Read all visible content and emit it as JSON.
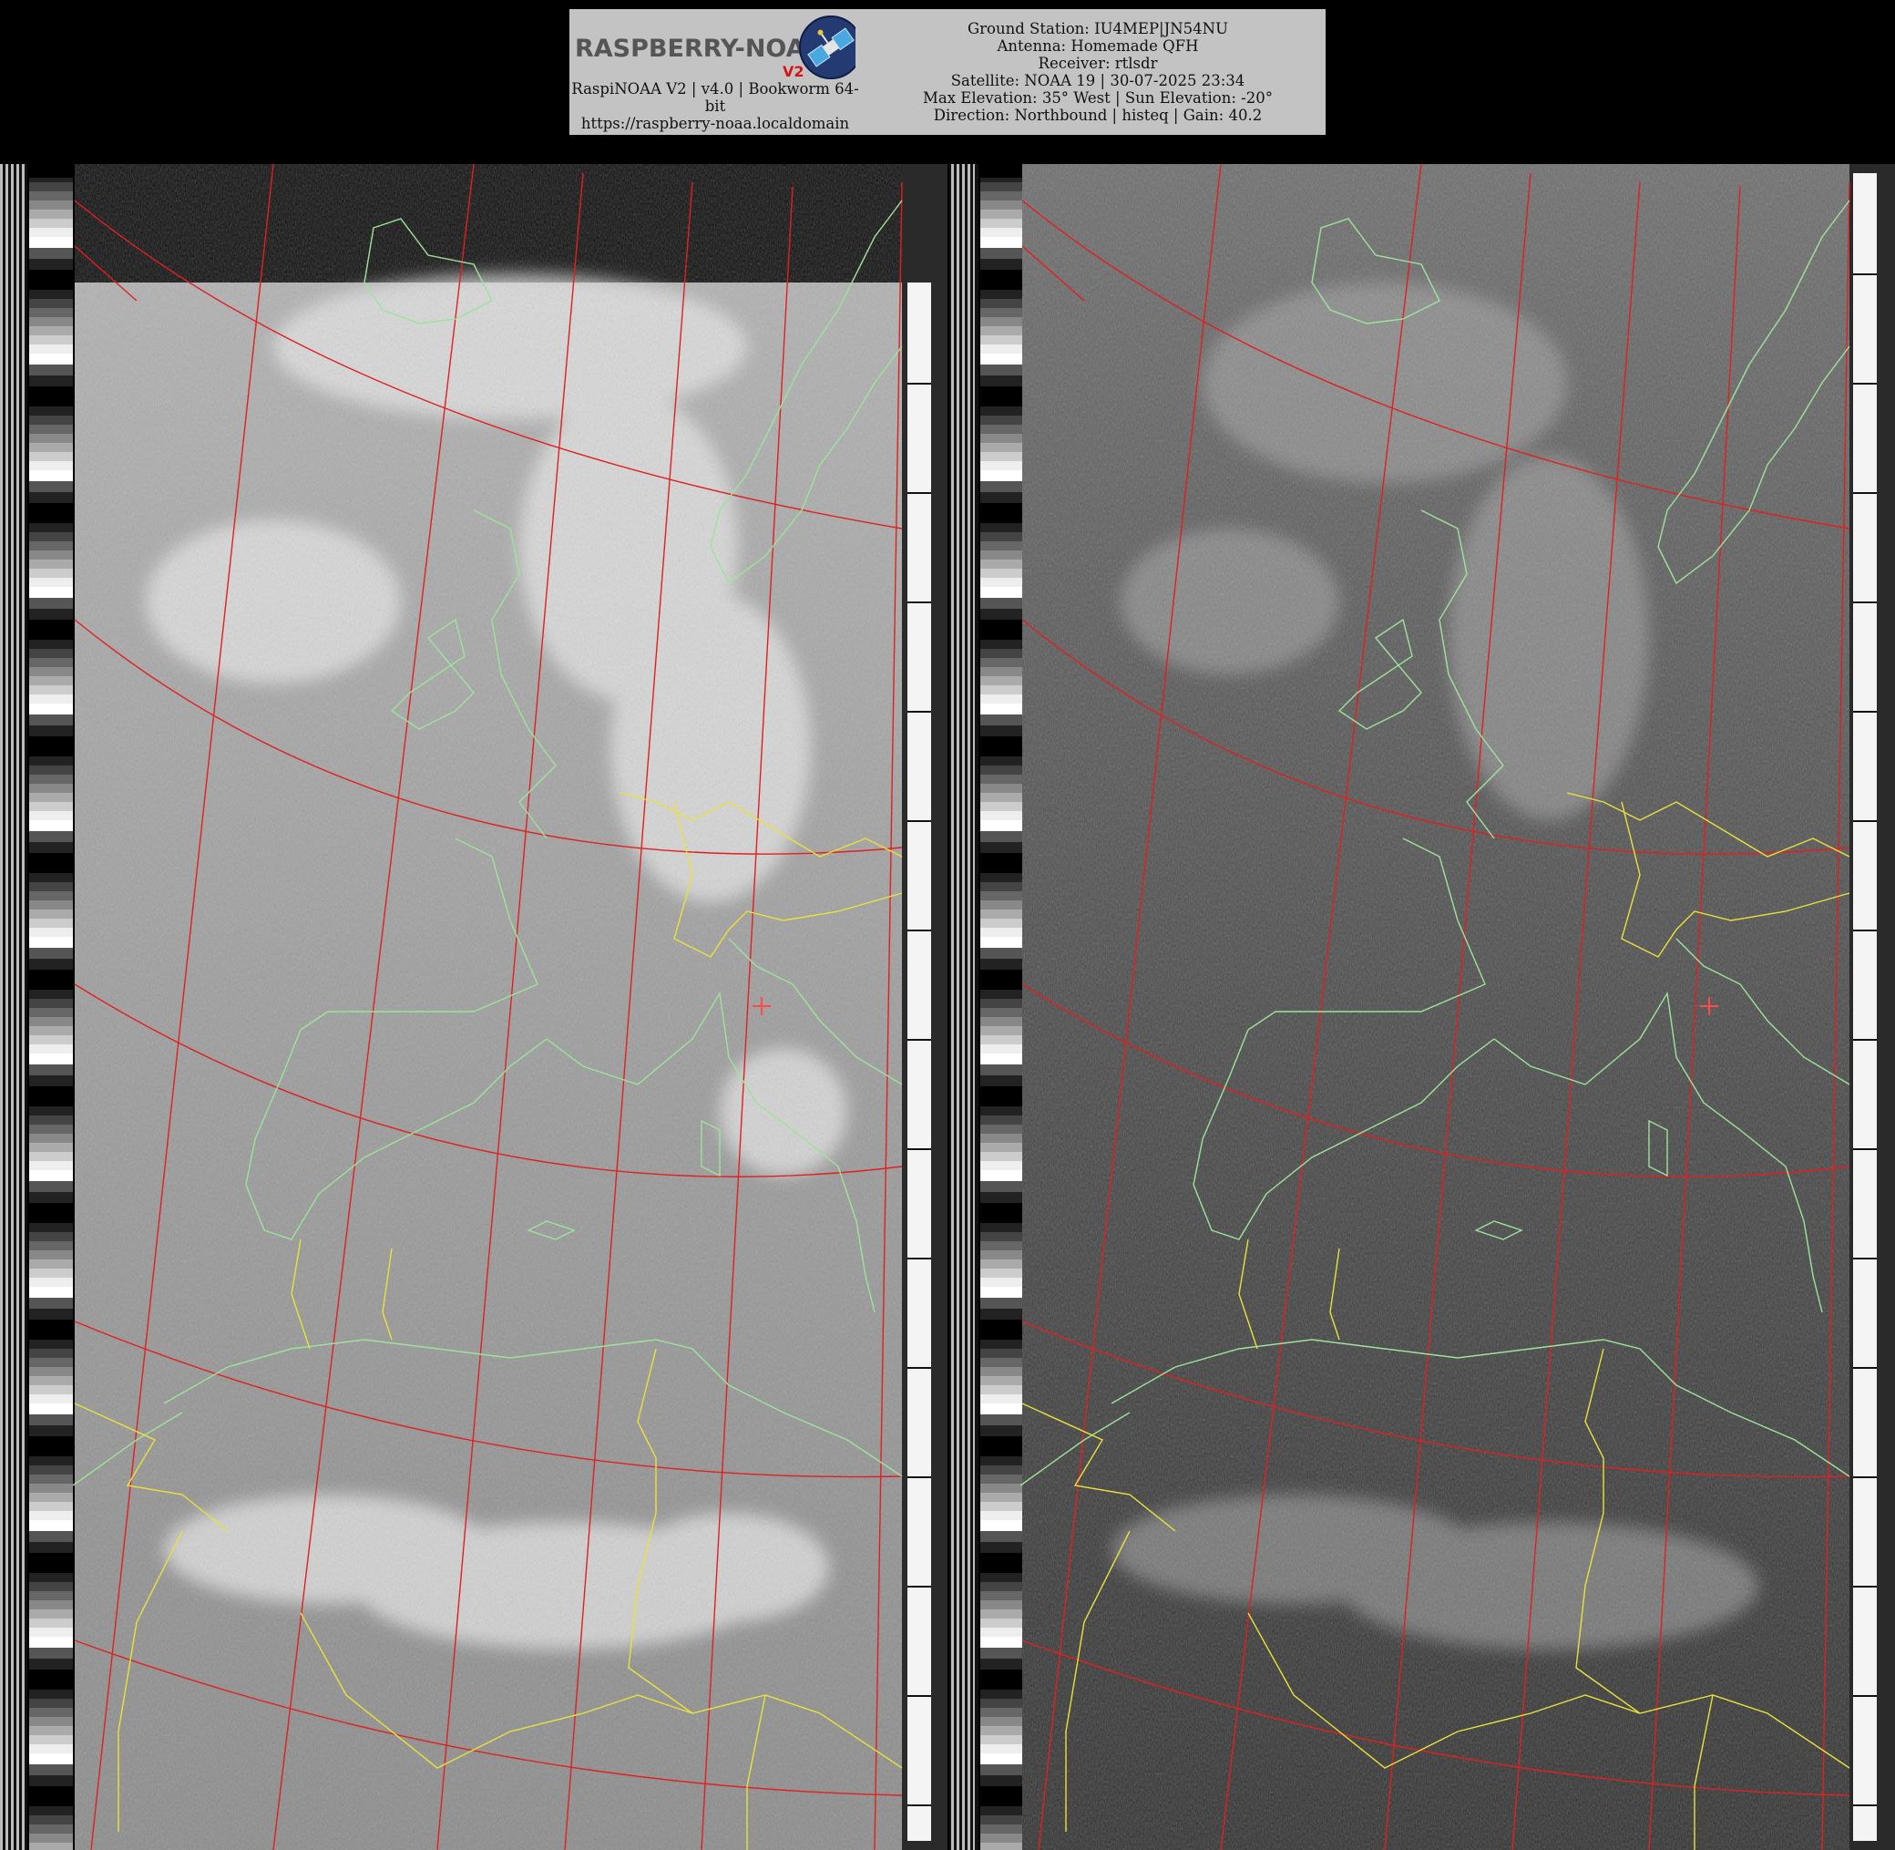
{
  "header": {
    "logo": {
      "wordmark": "RASPBERRY-NOAA",
      "badge": "V2",
      "icon": "satellite-icon"
    },
    "left_lines": [
      "RaspiNOAA V2 | v4.0 | Bookworm 64-",
      "bit",
      "https://raspberry-noaa.localdomain"
    ],
    "right_lines": [
      "Ground Station: IU4MEP|JN54NU",
      "Antenna: Homemade QFH",
      "Receiver: rtlsdr",
      "Satellite: NOAA 19 | 30-07-2025 23:34",
      "Max Elevation: 35° West | Sun Elevation: -20°",
      "Direction: Northbound | histeq | Gain: 40.2"
    ]
  },
  "imagery": {
    "panels": [
      {
        "channel": "A",
        "tone": "light"
      },
      {
        "channel": "B",
        "tone": "dark"
      }
    ],
    "overlay_colors": {
      "graticule": "#e02020",
      "coastline": "#9de39a",
      "borders": "#e8e23a",
      "marker": "#ff4a4a"
    }
  }
}
